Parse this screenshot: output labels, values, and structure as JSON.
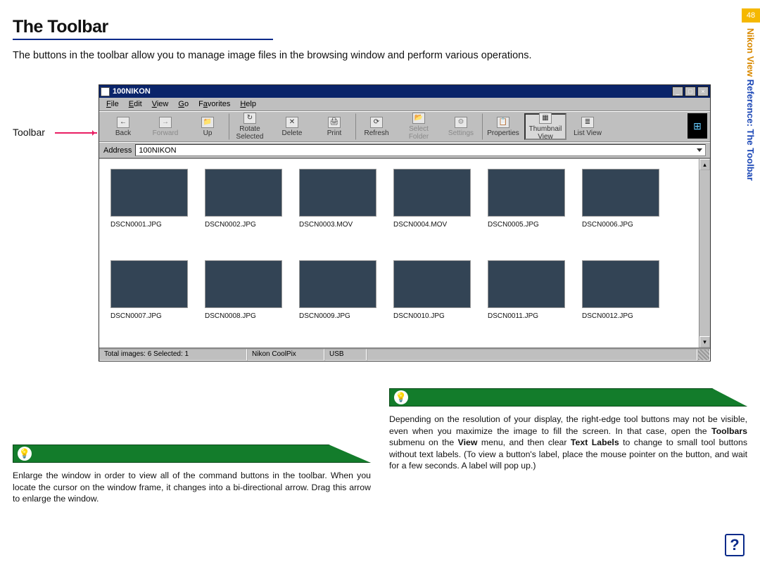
{
  "page_number": "48",
  "doc_heading": "The Toolbar",
  "intro": "The buttons in the toolbar allow you to manage image files in the browsing window and perform various operations.",
  "toolbar_callout": "Toolbar",
  "side_label_part1": "Nikon View ",
  "side_label_part2": "Reference: The Toolbar",
  "window": {
    "title": "100NIKON",
    "minimize": "_",
    "maximize": "□",
    "close": "×",
    "menu": {
      "file": "File",
      "edit": "Edit",
      "view": "View",
      "go": "Go",
      "favorites": "Favorites",
      "help": "Help"
    },
    "buttons": {
      "back": "Back",
      "forward": "Forward",
      "up": "Up",
      "rotate": "Rotate Selected",
      "delete": "Delete",
      "print": "Print",
      "refresh": "Refresh",
      "selectfolder": "Select Folder",
      "settings": "Settings",
      "properties": "Properties",
      "thumbnail": "Thumbnail View",
      "list": "List View"
    },
    "address_label": "Address",
    "address_value": "100NIKON",
    "thumbs": [
      "DSCN0001.JPG",
      "DSCN0002.JPG",
      "DSCN0003.MOV",
      "DSCN0004.MOV",
      "DSCN0005.JPG",
      "DSCN0006.JPG",
      "DSCN0007.JPG",
      "DSCN0008.JPG",
      "DSCN0009.JPG",
      "DSCN0010.JPG",
      "DSCN0011.JPG",
      "DSCN0012.JPG"
    ],
    "status": {
      "images": "Total images: 6   Selected: 1",
      "device": "Nikon CoolPix",
      "conn": "USB"
    }
  },
  "tips": {
    "left": "Enlarge the window in order to view all of the command buttons in the toolbar. When you locate the cursor on the window frame, it changes into a bi-directional arrow.  Drag this arrow to enlarge the window.",
    "right_pre": "Depending on the resolution of your display, the right-edge tool buttons may not be visible, even when you maximize the image to fill the screen.  In that case, open the ",
    "right_b1": "Toolbars",
    "right_mid1": " submenu on the ",
    "right_b2": "View",
    "right_mid2": " menu, and then clear ",
    "right_b3": "Text Labels",
    "right_post": " to change to small tool buttons without text labels.  (To view a button's label, place the mouse pointer on the button, and wait for a few seconds.  A label will pop up.)"
  },
  "icons": {
    "back": "←",
    "forward": "→",
    "up": "📁",
    "rotate": "↻",
    "delete": "✕",
    "print": "🖨",
    "refresh": "⟳",
    "selectfolder": "📂",
    "settings": "⚙",
    "properties": "📋",
    "thumbnail": "▦",
    "list": "≣"
  },
  "help_glyph": "?"
}
